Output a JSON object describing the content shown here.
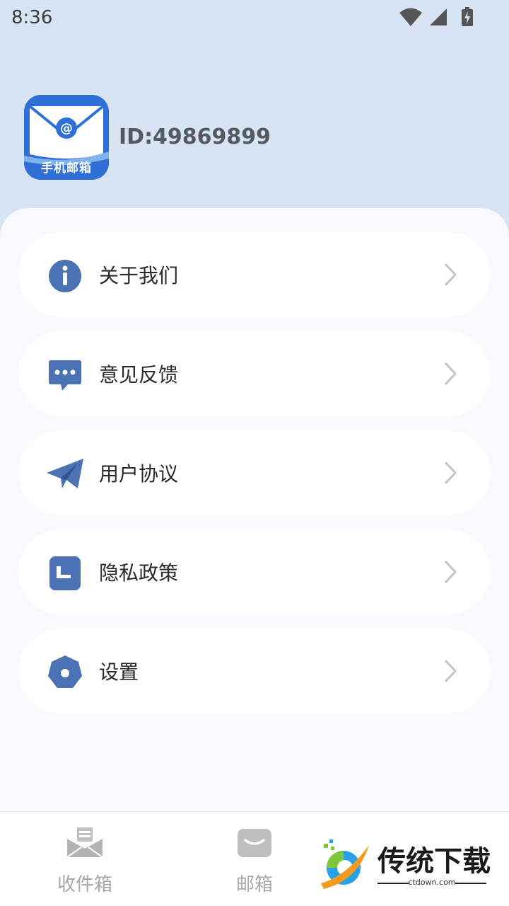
{
  "status_bar": {
    "time": "8:36",
    "icons": [
      "wifi-icon",
      "signal-icon",
      "battery-charging-icon"
    ]
  },
  "profile": {
    "app_logo_label": "手机邮箱",
    "user_id": "ID:49869899"
  },
  "menu": {
    "items": [
      {
        "label": "关于我们",
        "icon": "info-icon"
      },
      {
        "label": "意见反馈",
        "icon": "chat-bubble-icon"
      },
      {
        "label": "用户协议",
        "icon": "paper-plane-icon"
      },
      {
        "label": "隐私政策",
        "icon": "document-icon"
      },
      {
        "label": "设置",
        "icon": "octagon-settings-icon"
      }
    ]
  },
  "bottom_nav": {
    "tabs": [
      {
        "label": "收件箱",
        "icon": "inbox-envelope-icon"
      },
      {
        "label": "邮箱",
        "icon": "mail-icon"
      }
    ]
  },
  "watermark": {
    "title": "传统下载",
    "subtitle": "ctdown.com"
  },
  "colors": {
    "header_bg": "#d6e4f3",
    "accent_icon": "#4a72b4",
    "panel_bg": "#f7f9fc",
    "inactive_tab": "#a8a8a8"
  }
}
